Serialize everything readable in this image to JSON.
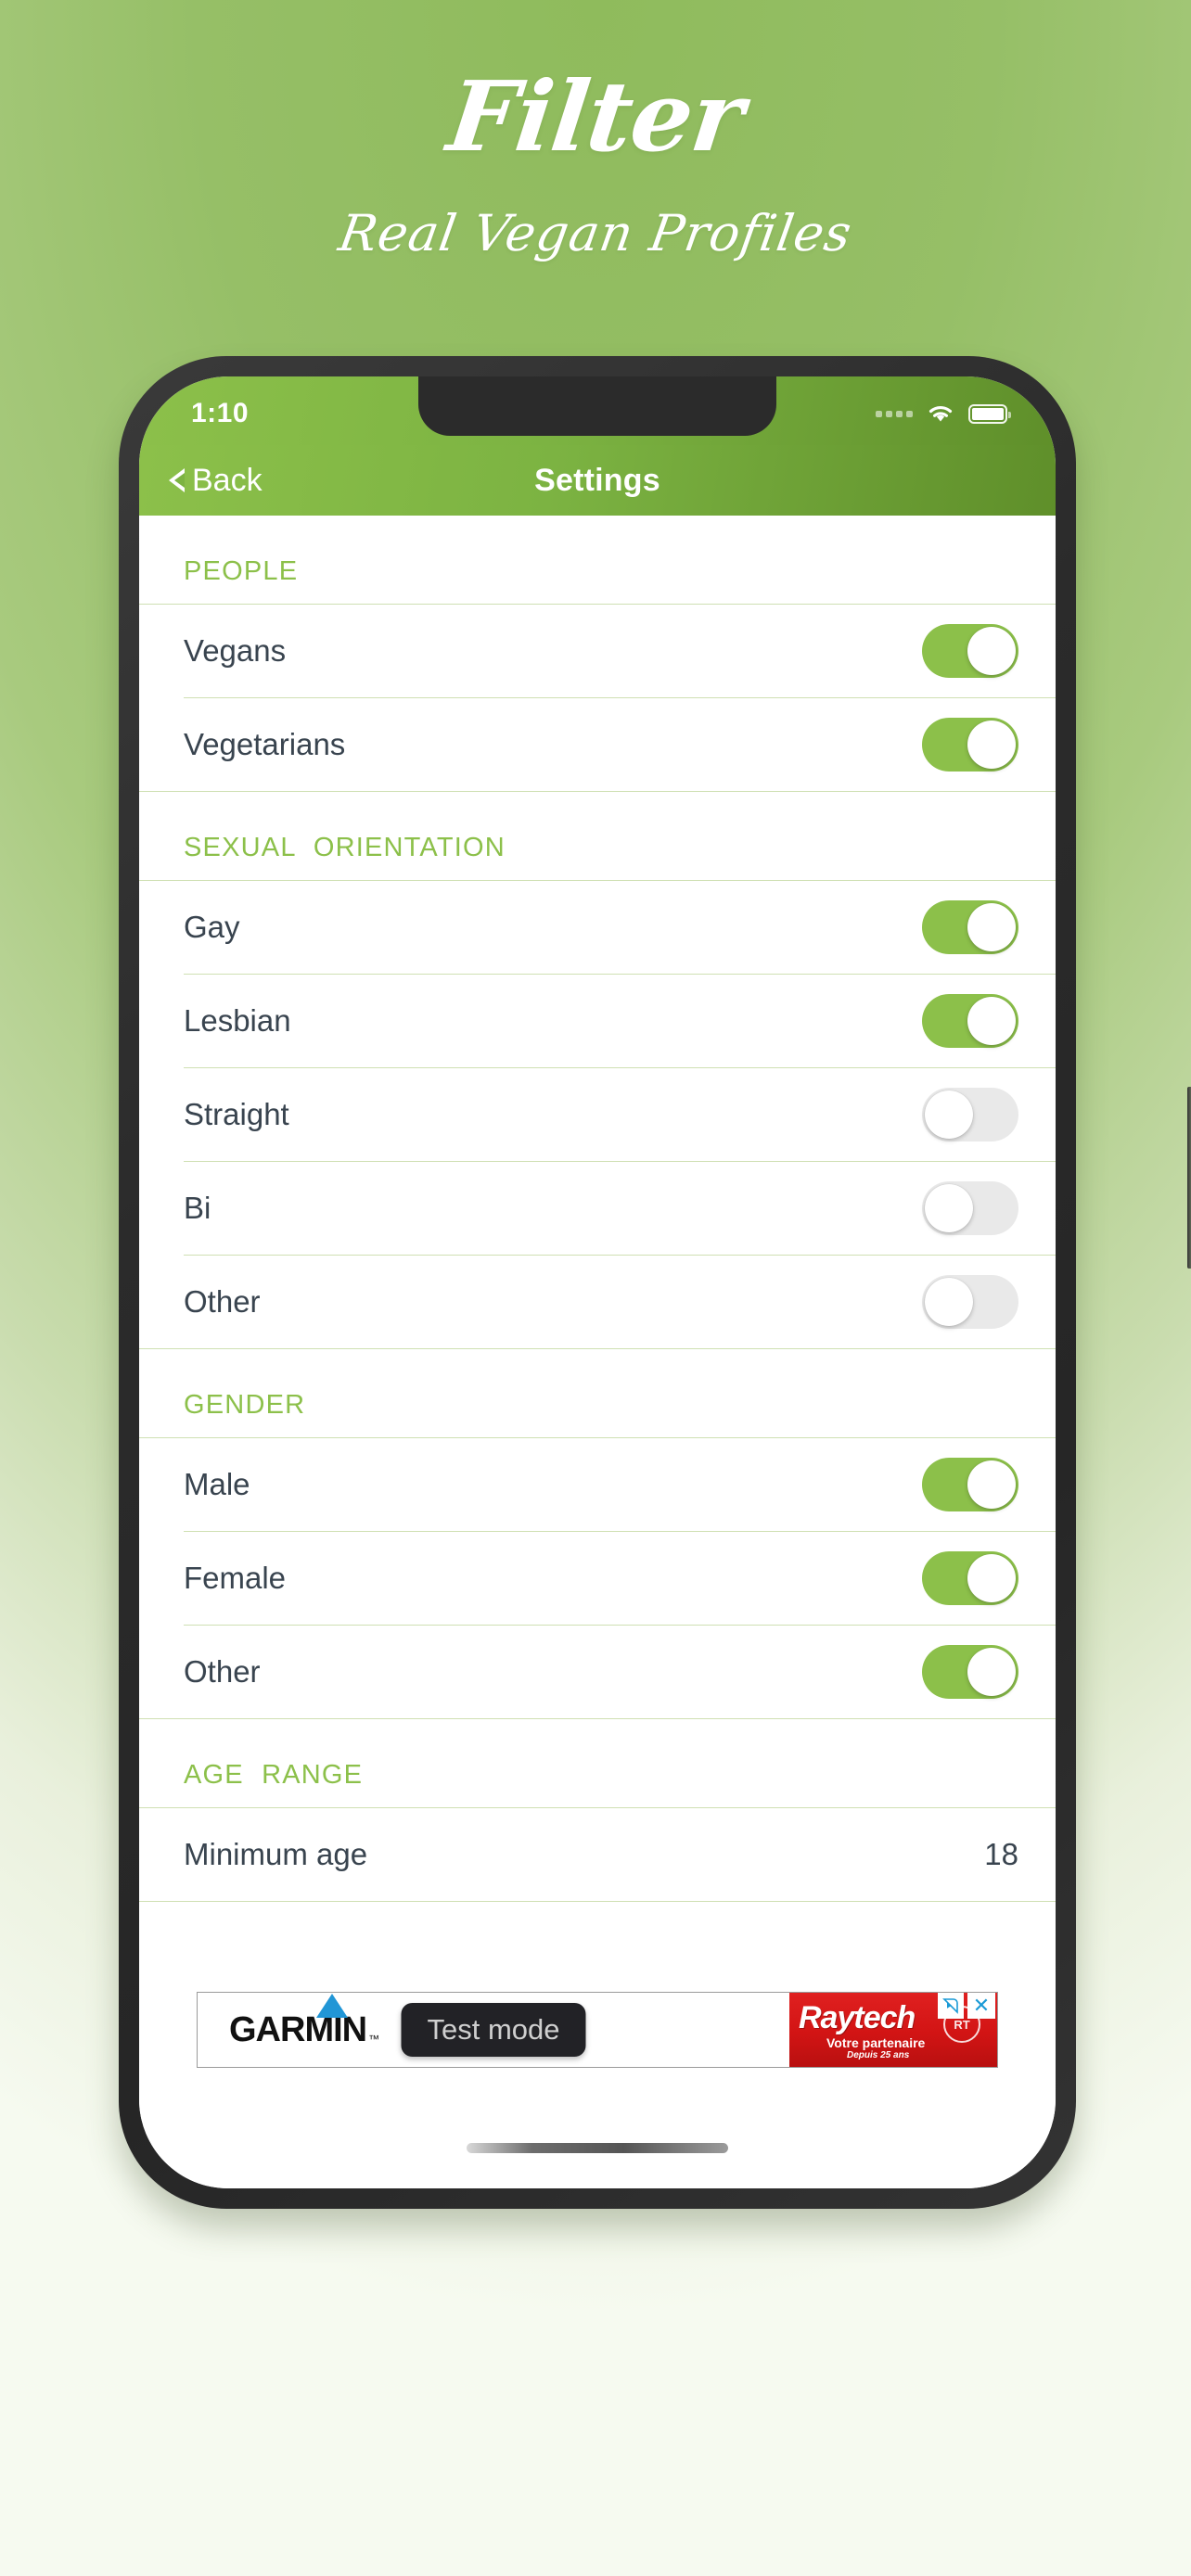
{
  "promo": {
    "title": "Filter",
    "subtitle": "Real Vegan Profiles"
  },
  "colors": {
    "accent_green": "#8cc04a",
    "nav_gradient_start": "#8cc04a",
    "nav_gradient_end": "#5f8f2a",
    "row_text": "#39444f",
    "divider": "#cfe0b3",
    "toggle_off": "#e9e9e9",
    "background_top": "#8fbb5c",
    "background_bottom": "#f6faf0",
    "phone_frame": "#2b2b2b"
  },
  "statusbar": {
    "time": "1:10",
    "signal_icon": "signal-dots-icon",
    "wifi_icon": "wifi-icon",
    "battery_icon": "battery-full-icon"
  },
  "navbar": {
    "back_label": "Back",
    "back_icon": "chevron-left-icon",
    "title": "Settings"
  },
  "sections": [
    {
      "header": "PEOPLE",
      "rows": [
        {
          "label": "Vegans",
          "type": "toggle",
          "state": "on"
        },
        {
          "label": "Vegetarians",
          "type": "toggle",
          "state": "on"
        }
      ]
    },
    {
      "header": "SEXUAL ORIENTATION",
      "rows": [
        {
          "label": "Gay",
          "type": "toggle",
          "state": "on"
        },
        {
          "label": "Lesbian",
          "type": "toggle",
          "state": "on"
        },
        {
          "label": "Straight",
          "type": "toggle",
          "state": "off"
        },
        {
          "label": "Bi",
          "type": "toggle",
          "state": "off"
        },
        {
          "label": "Other",
          "type": "toggle",
          "state": "off"
        }
      ]
    },
    {
      "header": "GENDER",
      "rows": [
        {
          "label": "Male",
          "type": "toggle",
          "state": "on"
        },
        {
          "label": "Female",
          "type": "toggle",
          "state": "on"
        },
        {
          "label": "Other",
          "type": "toggle",
          "state": "on"
        }
      ]
    },
    {
      "header": "AGE RANGE",
      "rows": [
        {
          "label": "Minimum age",
          "type": "value",
          "value": "18"
        }
      ]
    }
  ],
  "ad": {
    "brand": "GARMIN",
    "brand_tm": "™",
    "test_mode_label": "Test mode",
    "partner_name": "Raytech",
    "partner_tagline": "Votre partenaire",
    "partner_since": "Depuis 25 ans",
    "partner_logo_text": "RT",
    "adchoices_icon": "adchoices-icon",
    "close_icon": "close-icon",
    "close_label": "✕"
  },
  "phone": {
    "home_indicator": "home-indicator",
    "buttons": [
      "mute-switch",
      "volume-up",
      "volume-down",
      "power"
    ]
  }
}
